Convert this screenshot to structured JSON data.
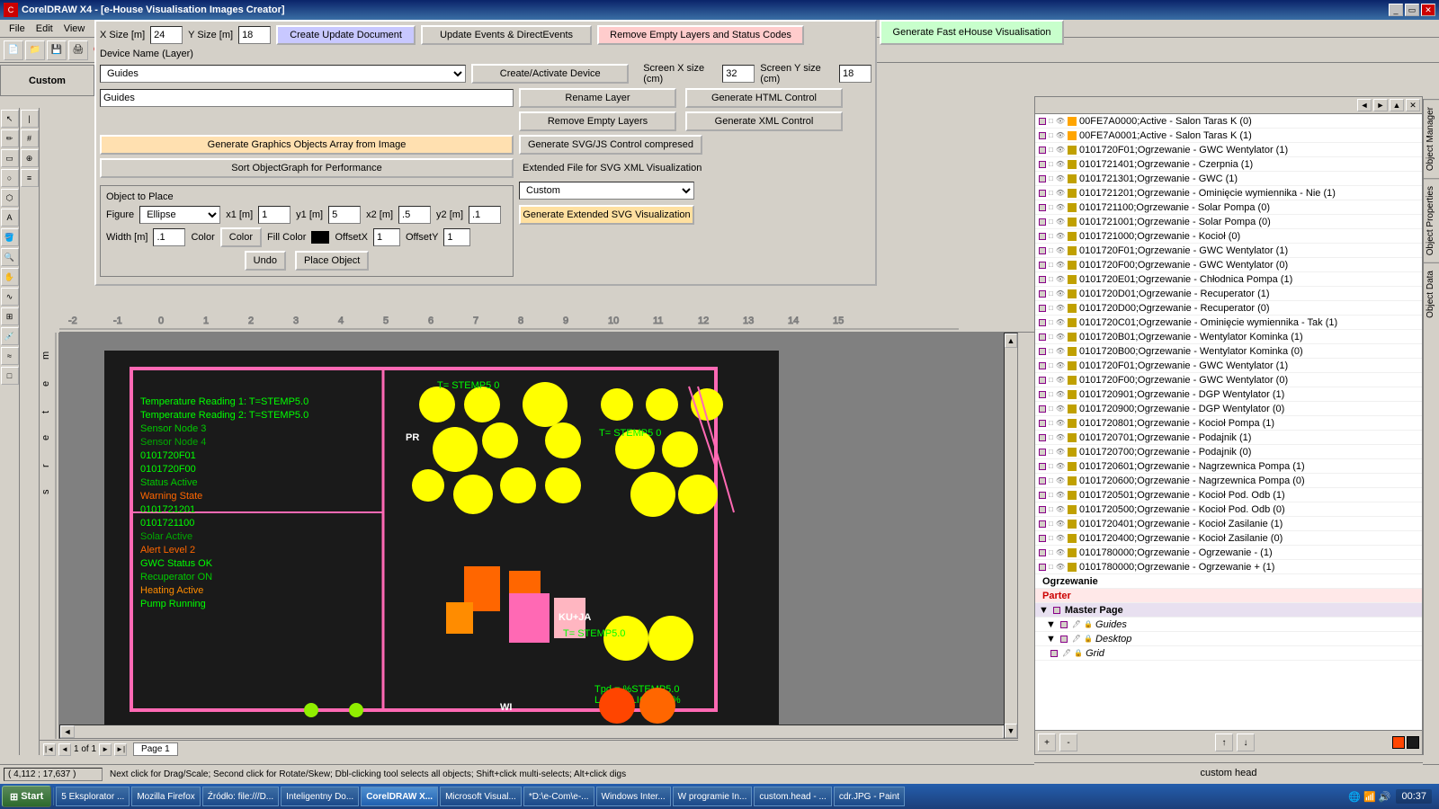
{
  "window": {
    "title": "CorelDRAW X4 - [e-House Visualisation Images Creator]",
    "app_title": "CorelDRAW X4",
    "dialog_title": "e-House Visualisation Images Creator"
  },
  "menu": {
    "items": [
      "File",
      "Edit",
      "View"
    ]
  },
  "form": {
    "x_size_label": "X Size [m]",
    "y_size_label": "Y Size [m]",
    "x_size_value": "24",
    "y_size_value": "18",
    "create_btn": "Create Update Document",
    "update_events_btn": "Update Events & DirectEvents",
    "remove_empty_status_btn": "Remove Empty Layers and Status Codes",
    "device_name_label": "Device Name (Layer)",
    "device_dropdown": "Guides",
    "device_text": "Guides",
    "create_activate_btn": "Create/Activate Device",
    "rename_layer_btn": "Rename Layer",
    "remove_empty_btn": "Remove Empty Layers",
    "generate_graphics_btn": "Generate Graphics Objects Array from Image",
    "sort_objectgraph_btn": "Sort ObjectGraph for Performance",
    "screen_x_label": "Screen X size (cm)",
    "screen_y_label": "Screen Y size (cm)",
    "screen_x_value": "32",
    "screen_y_value": "18",
    "generate_html_btn": "Generate HTML Control",
    "generate_xml_btn": "Generate XML Control",
    "generate_svg_btn": "Generate SVG/JS Control compresed",
    "extended_label": "Extended File for SVG XML Visualization",
    "extended_dropdown": "Custom",
    "generate_extended_btn": "Generate Extended SVG Visualization",
    "generate_fast_btn": "Generate Fast eHouse Visualisation"
  },
  "object_to_place": {
    "title": "Object to Place",
    "figure_label": "Figure",
    "figure_value": "Ellipse",
    "x1_label": "x1 [m]",
    "x1_value": "1",
    "y1_label": "y1 [m]",
    "y1_value": "5",
    "x2_label": "x2 [m]",
    "x2_value": ".5",
    "y2_label": "y2 [m]",
    "y2_value": ".1",
    "width_label": "Width [m]",
    "width_value": ".1",
    "color_label": "Color",
    "color_btn": "Color",
    "fill_color_label": "Fill Color",
    "offsetx_label": "OffsetX",
    "offsetx_value": "1",
    "offsety_label": "OffsetY",
    "offsety_value": "1",
    "undo_btn": "Undo",
    "place_btn": "Place Object"
  },
  "page_nav": {
    "of_label": "1 of 1",
    "page_label": "Page 1"
  },
  "status": {
    "coords": "( 4,112 ; 17,637 )",
    "message": "Next click for Drag/Scale; Second click for Rotate/Skew; Dbl-clicking tool selects all objects; Shift+click multi-selects; Alt+click digs"
  },
  "object_manager": {
    "title": "Object Manager",
    "items": [
      "00FE7A0000;Active - Salon Taras K (0)",
      "00FE7A0001;Active - Salon Taras K (1)",
      "0101720F01;Ogrzewanie - GWC Wentylator (1)",
      "0101721401;Ogrzewanie - Czerpnia (1)",
      "0101721301;Ogrzewanie - GWC (1)",
      "0101721201;Ogrzewanie - Ominięcie wymiennika - Nie (1)",
      "0101721100;Ogrzewanie - Solar Pompa (0)",
      "0101721001;Ogrzewanie - Solar Pompa (0)",
      "0101721000;Ogrzewanie - Kocioł (0)",
      "0101720F01;Ogrzewanie - GWC Wentylator (1)",
      "0101720F00;Ogrzewanie - GWC Wentylator (0)",
      "0101720E01;Ogrzewanie - Chłodnica Pompa (1)",
      "0101720D01;Ogrzewanie - Recuperator (1)",
      "0101720D00;Ogrzewanie - Recuperator (0)",
      "0101720C01;Ogrzewanie - Ominięcie wymiennika - Tak (1)",
      "0101720B01;Ogrzewanie - Wentylator Kominka (1)",
      "0101720B00;Ogrzewanie - Wentylator Kominka (0)",
      "0101720F01;Ogrzewanie - GWC Wentylator (1)",
      "0101720F00;Ogrzewanie - GWC Wentylator (0)",
      "0101720901;Ogrzewanie - DGP Wentylator (1)",
      "0101720900;Ogrzewanie - DGP Wentylator (0)",
      "0101720801;Ogrzewanie - Kocioł Pompa (1)",
      "0101720701;Ogrzewanie - Podajnik (1)",
      "0101720700;Ogrzewanie - Podajnik (0)",
      "0101720601;Ogrzewanie - Nagrzewnica Pompa (1)",
      "0101720600;Ogrzewanie - Nagrzewnica Pompa (0)",
      "0101720501;Ogrzewanie - Kocioł Pod. Odb (1)",
      "0101720500;Ogrzewanie - Kocioł Pod. Odb (0)",
      "0101720401;Ogrzewanie - Kocioł Zasilanie (1)",
      "0101720400;Ogrzewanie - Kocioł Zasilanie (0)",
      "0101780000;Ogrzewanie - Ogrzewanie - (1)",
      "0101780000;Ogrzewanie - Ogrzewanie + (1)",
      "Ogrzewanie",
      "Parter"
    ],
    "master_page": "Master Page",
    "layers": [
      "Guides",
      "Desktop",
      "Grid"
    ],
    "custom_label": "custom head"
  },
  "side_tabs": [
    "Object Manager",
    "Object Properties",
    "Object Data"
  ],
  "taskbar": {
    "start_label": "Start",
    "items": [
      "5 Eksplorator ...",
      "Mozilla Firefox",
      "Źródło: file:///D...",
      "Inteligentny Do...",
      "CorelDRAW X...",
      "Microsoft Visual...",
      "*D:\\e-Com\\e-...",
      "Windows Inter...",
      "W programie In...",
      "custom.head - ...",
      "cdr.JPG - Paint"
    ],
    "time": "00:37"
  },
  "colors": {
    "accent_blue": "#0a246a",
    "accent_light": "#3a6ea5",
    "selected": "#316ac5",
    "parter_color": "#cc0000"
  }
}
